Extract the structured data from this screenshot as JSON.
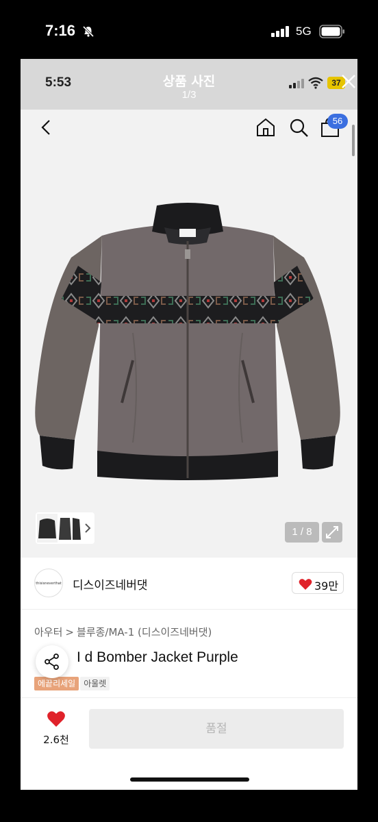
{
  "outer_status": {
    "time": "7:16",
    "network": "5G"
  },
  "inner_status": {
    "time": "5:53",
    "battery": "37"
  },
  "viewer": {
    "title": "상품 사진",
    "counter": "1/3"
  },
  "nav": {
    "cart_count": "56"
  },
  "gallery": {
    "counter": "1 / 8"
  },
  "brand": {
    "name": "디스이즈네버댓",
    "logo_text": "thisisneverthat",
    "likes": "39만"
  },
  "breadcrumb": {
    "level1": "아우터",
    "level2": "블루종/MA-1 (디스이즈네버댓)"
  },
  "product": {
    "title": "I    d Bomber Jacket Purple"
  },
  "tags": [
    "에끝리세일",
    "아울렛"
  ],
  "bottom": {
    "wish_count": "2.6천",
    "buy_label": "품절"
  },
  "colors": {
    "accent_blue": "#3b6fe0",
    "heart_red": "#e0222a",
    "sale_tag": "#e8a37a",
    "jacket": "#6d6562"
  }
}
